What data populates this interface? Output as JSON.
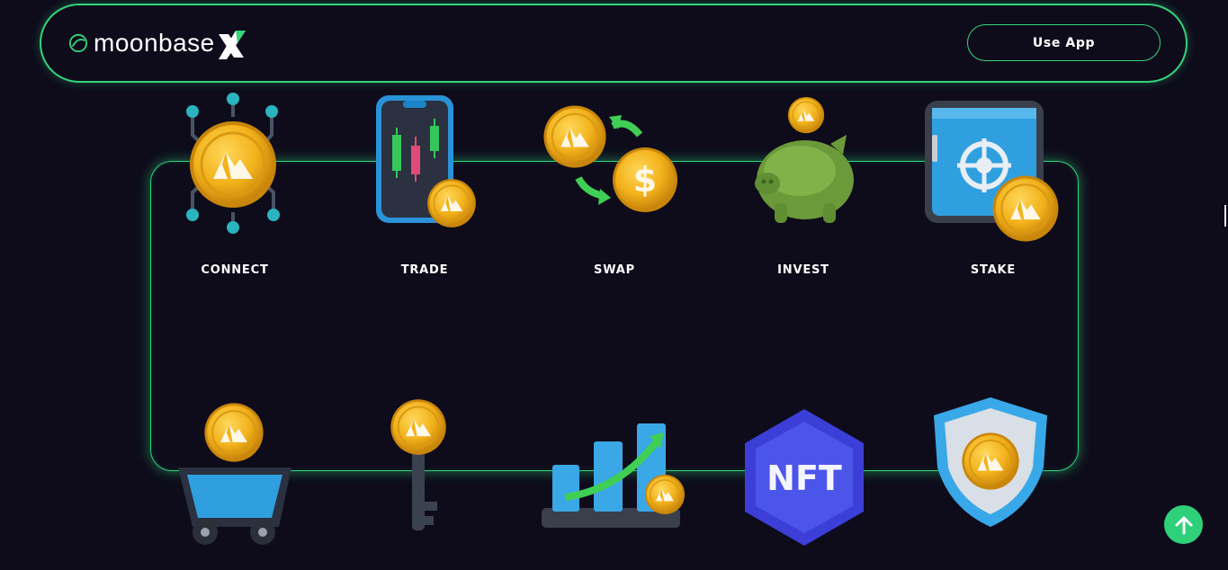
{
  "brand": {
    "name": "moonbase"
  },
  "header": {
    "cta_label": "Use App"
  },
  "features": [
    {
      "label": "CONNECT",
      "icon": "connect-icon"
    },
    {
      "label": "TRADE",
      "icon": "trade-icon"
    },
    {
      "label": "SWAP",
      "icon": "swap-icon"
    },
    {
      "label": "INVEST",
      "icon": "piggy-bank-icon"
    },
    {
      "label": "STAKE",
      "icon": "vault-icon"
    }
  ],
  "features_row2": [
    {
      "icon": "mining-cart-icon"
    },
    {
      "icon": "key-icon"
    },
    {
      "icon": "growth-chart-icon"
    },
    {
      "icon": "nft-icon",
      "text": "NFT"
    },
    {
      "icon": "shield-icon"
    }
  ],
  "colors": {
    "accent": "#35d57a",
    "background": "#0e0c1b",
    "coin": "#f2b21b"
  }
}
